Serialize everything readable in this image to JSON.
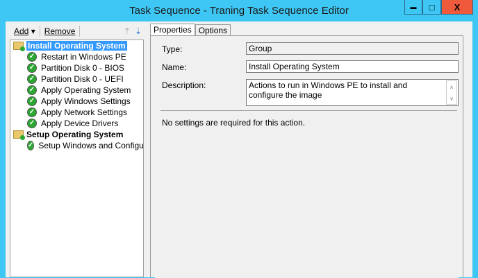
{
  "window": {
    "title": "Task Sequence - Traning Task Sequence Editor",
    "minimize": "▬",
    "maximize": "□",
    "close": "X",
    "close_color": "#f05a3c"
  },
  "toolbar": {
    "add": "Add",
    "remove": "Remove"
  },
  "tree": [
    {
      "label": "Install Operating System",
      "type": "group",
      "selected": true
    },
    {
      "label": "Restart in Windows PE",
      "type": "step"
    },
    {
      "label": "Partition Disk 0 - BIOS",
      "type": "step"
    },
    {
      "label": "Partition Disk 0 - UEFI",
      "type": "step"
    },
    {
      "label": "Apply Operating System",
      "type": "step"
    },
    {
      "label": "Apply Windows Settings",
      "type": "step"
    },
    {
      "label": "Apply Network Settings",
      "type": "step"
    },
    {
      "label": "Apply Device Drivers",
      "type": "step"
    },
    {
      "label": "Setup Operating System",
      "type": "group"
    },
    {
      "label": "Setup Windows and Configuration",
      "type": "step"
    }
  ],
  "tabs": {
    "properties": "Properties",
    "options": "Options"
  },
  "props": {
    "type_label": "Type:",
    "type_value": "Group",
    "name_label": "Name:",
    "name_value": "Install Operating System",
    "desc_label": "Description:",
    "desc_value": "Actions to run in Windows PE to install and configure the image",
    "note": "No settings are required  for this action."
  }
}
